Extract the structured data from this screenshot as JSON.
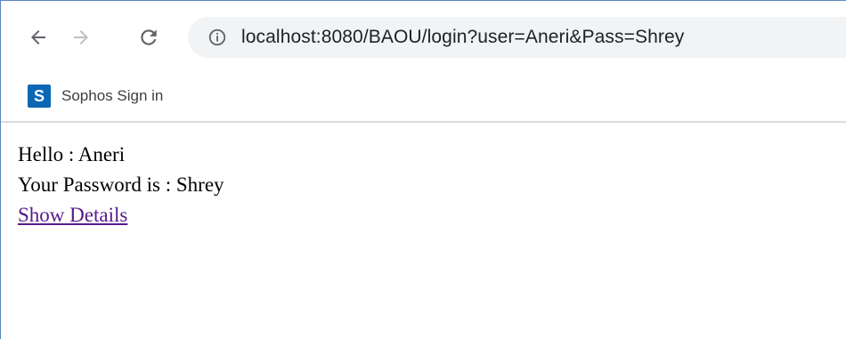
{
  "browser": {
    "url": "localhost:8080/BAOU/login?user=Aneri&Pass=Shrey",
    "nav": {
      "back_icon": "arrow-left-icon",
      "forward_icon": "arrow-right-icon",
      "reload_icon": "reload-icon",
      "info_icon": "info-icon"
    },
    "bookmarks": [
      {
        "label": "Sophos Sign in",
        "icon_letter": "S",
        "icon_color": "#0c68b4"
      }
    ]
  },
  "page": {
    "greeting": "Hello : Aneri",
    "password_line": "Your Password is : Shrey",
    "details_link": "Show Details",
    "link_color": "#551a8b"
  }
}
